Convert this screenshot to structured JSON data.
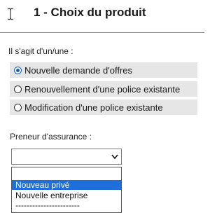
{
  "header": {
    "title": "1 - Choix du produit",
    "cursor_icon": "text-cursor-icon"
  },
  "question": {
    "label": "Il s'agit d'un/une :",
    "options": [
      {
        "label": "Nouvelle demande d'offres",
        "checked": true
      },
      {
        "label": "Renouvellement d'une police existante",
        "checked": false
      },
      {
        "label": "Modification d'une police existante",
        "checked": false
      }
    ]
  },
  "preneur": {
    "label": "Preneur d'assurance :",
    "select_value": "",
    "chevron_icon": "chevron-down-icon",
    "dropdown_options": [
      "",
      "Nouveau privé",
      "Nouvelle entreprise",
      "-----------------------"
    ],
    "highlighted_option": "Nouveau privé"
  },
  "colors": {
    "highlight": "#1e6fd9",
    "radio_row_bg": "#e6e6e6"
  }
}
